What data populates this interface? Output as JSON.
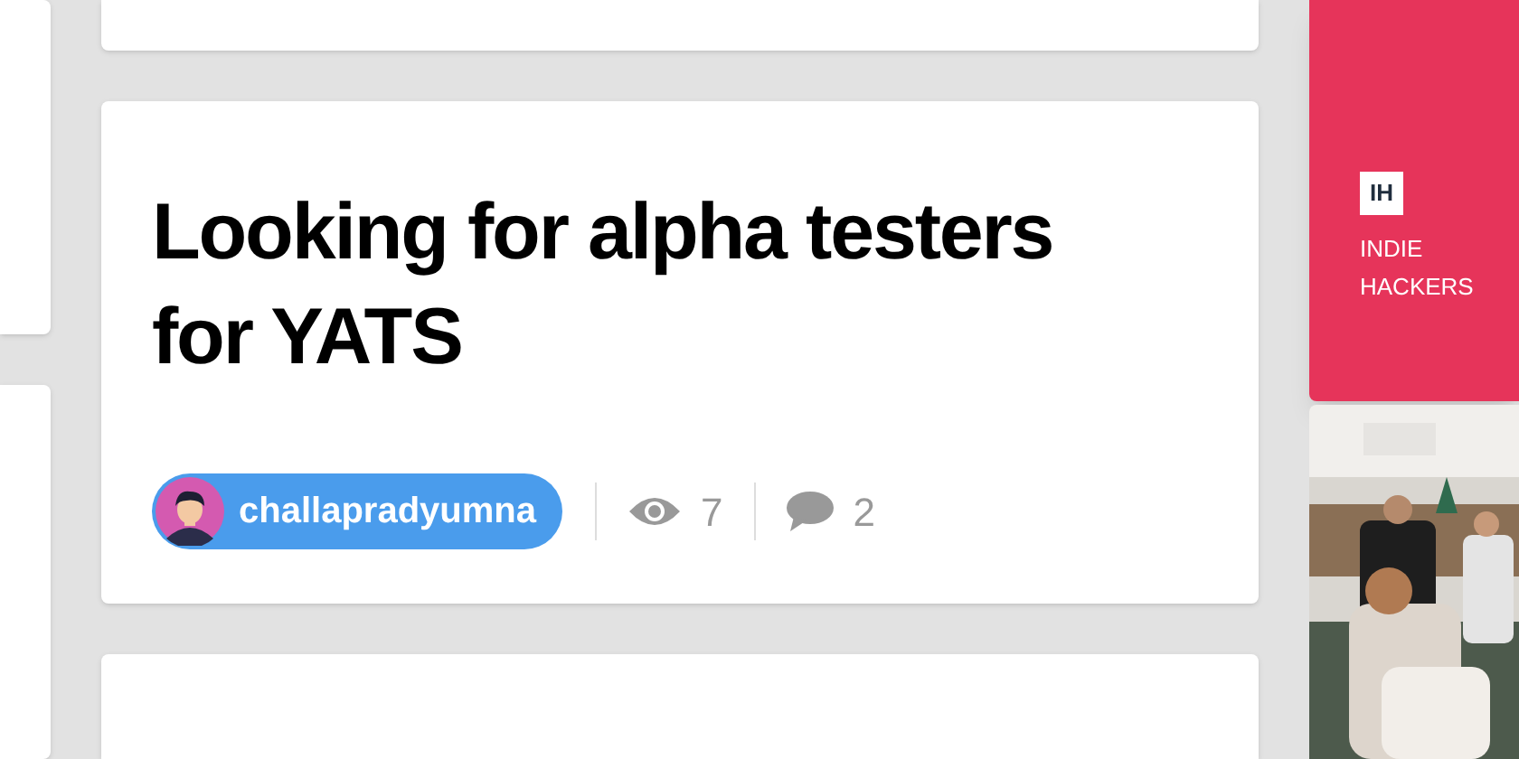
{
  "post": {
    "title": "Looking for alpha testers for YATS",
    "author": {
      "username": "challapradyumna"
    },
    "views": "7",
    "comments": "2"
  },
  "sidebar": {
    "brand": {
      "logo": "IH",
      "name": "INDIE HACKERS"
    }
  }
}
